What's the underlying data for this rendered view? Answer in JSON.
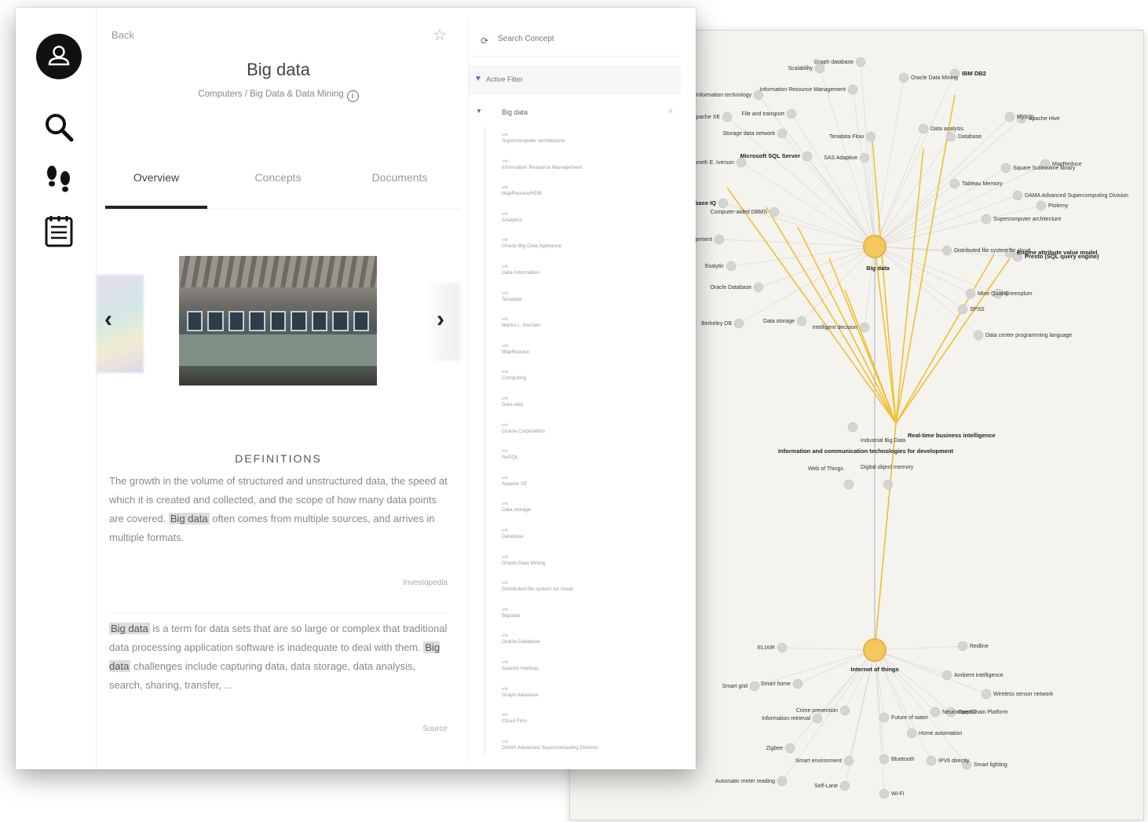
{
  "graph": {
    "center_nodes": [
      "Big data",
      "Internet of things"
    ],
    "hub_labels": [
      "Real-time business intelligence",
      "Information and communication technologies for development",
      "Web of Things",
      "Digital object memory",
      "Industrial Big Data"
    ],
    "upper_labels": [
      "Graph database",
      "Scalability",
      "Oracle Data Mining",
      "IBM DB2",
      "Information technology",
      "Information Resource Management",
      "Apache XE",
      "File and transport",
      "Storage data network",
      "Teradata Flow",
      "Data analysis",
      "Database",
      "Microsoft SQL Server",
      "SAS Adaptive",
      "Kenneth E. Iverson",
      "Sybase IQ",
      "Computer-aided DBMS",
      "Big Data Management",
      "Exalytic",
      "Oracle Database",
      "Berkeley DB",
      "Data storage",
      "Intelligent decision",
      "Data center programming language",
      "MySQL",
      "Square Subroutine library",
      "Tableau Memory",
      "DAMA Advanced Supercomputing Division",
      "Supercomputer architecture",
      "Distributed file system for cloud",
      "Engine attribute value model",
      "Presto (SQL query engine)",
      "Mine Quality",
      "SPSS",
      "Greenplum",
      "Ptolemy",
      "MapReduce",
      "Apache Hive"
    ],
    "lower_labels": [
      "ELIXIR",
      "Redline",
      "Ambient intelligence",
      "Wireless sensor network",
      "Smart grid",
      "Smart home",
      "Information retrieval",
      "Crime prevention",
      "Future of water",
      "Home automation",
      "OpenChain Platform",
      "Zigbee",
      "Smart environment",
      "Bluetooth",
      "IPV6 directly",
      "Smart lighting",
      "Automatic meter reading",
      "Self-Lane",
      "Wi-Fi",
      "Neuromorphic"
    ]
  },
  "app": {
    "back": "Back",
    "title": "Big data",
    "breadcrumb": "Computers / Big Data & Data Mining",
    "tabs": [
      "Overview",
      "Concepts",
      "Documents"
    ],
    "definitions_heading": "DEFINITIONS",
    "def1": {
      "before": "The growth in the volume of structured and unstructured data, the speed at which it is created and collected, and the scope of how many data points are covered.",
      "highlight": "Big data",
      "after": "often comes from multiple sources, and arrives in multiple formats.",
      "source": "Investopedia"
    },
    "def2": {
      "hl1": "Big data",
      "mid": "is a term for data sets that are so large or complex that traditional data processing application software is inadequate to deal with them.",
      "hl2": "Big data",
      "after": "challenges include capturing data, data storage, data analysis, search, sharing, transfer, ...",
      "source": "Source"
    }
  },
  "filters": {
    "search_placeholder": "Search Concept",
    "active_filter": "Active Filter",
    "selected": "Big data",
    "items": [
      {
        "type": "wiki",
        "label": "Supercomputer architecture"
      },
      {
        "type": "wiki",
        "label": "Information Resource Management"
      },
      {
        "type": "wiki",
        "label": "MapReduce/HDB"
      },
      {
        "type": "wiki",
        "label": "Analytics"
      },
      {
        "type": "wiki",
        "label": "Oracle Big Data Appliance"
      },
      {
        "type": "wiki",
        "label": "Data Information"
      },
      {
        "type": "wiki",
        "label": "Teradata"
      },
      {
        "type": "wiki",
        "label": "Martin L. Kersten"
      },
      {
        "type": "wiki",
        "label": "MapReduce"
      },
      {
        "type": "wiki",
        "label": "Computing"
      },
      {
        "type": "wiki",
        "label": "Data lake"
      },
      {
        "type": "wiki",
        "label": "Oracle Corporation"
      },
      {
        "type": "wiki",
        "label": "NoSQL"
      },
      {
        "type": "wiki",
        "label": "Apache XE"
      },
      {
        "type": "wiki",
        "label": "Data storage"
      },
      {
        "type": "wiki",
        "label": "Database"
      },
      {
        "type": "wiki",
        "label": "Oracle Data Mining"
      },
      {
        "type": "wiki",
        "label": "Distributed file system for cloud"
      },
      {
        "type": "wiki",
        "label": "Bigtable"
      },
      {
        "type": "wiki",
        "label": "Oracle Database"
      },
      {
        "type": "wiki",
        "label": "Apache Hadoop"
      },
      {
        "type": "wiki",
        "label": "Graph database"
      },
      {
        "type": "wiki",
        "label": "Cloud Firm"
      },
      {
        "type": "wiki",
        "label": "DAMA Advanced Supercomputing Division"
      }
    ]
  }
}
